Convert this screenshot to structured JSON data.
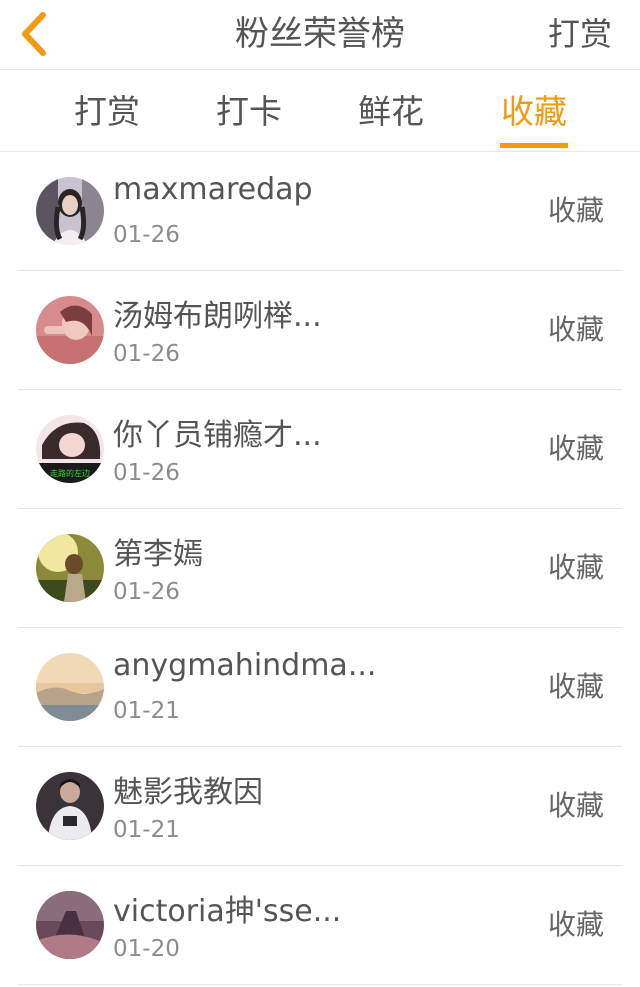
{
  "header": {
    "back_icon": "chevron-left-icon",
    "title": "粉丝荣誉榜",
    "action": "打赏",
    "accent": "#f29b12"
  },
  "tabs": [
    {
      "label": "打赏",
      "active": false
    },
    {
      "label": "打卡",
      "active": false
    },
    {
      "label": "鲜花",
      "active": false
    },
    {
      "label": "收藏",
      "active": true
    }
  ],
  "list": [
    {
      "name": "maxmaredap",
      "date": "01-26",
      "action": "收藏"
    },
    {
      "name": "汤姆布朗咧榉...",
      "date": "01-26",
      "action": "收藏"
    },
    {
      "name": "你丫员铺瘾才...",
      "date": "01-26",
      "action": "收藏"
    },
    {
      "name": "第李嫣",
      "date": "01-26",
      "action": "收藏"
    },
    {
      "name": "anygmahindma...",
      "date": "01-21",
      "action": "收藏"
    },
    {
      "name": "魅影我教因",
      "date": "01-21",
      "action": "收藏"
    },
    {
      "name": "victoria抻'sse...",
      "date": "01-20",
      "action": "收藏"
    }
  ],
  "avatar_text": "走路的左边"
}
